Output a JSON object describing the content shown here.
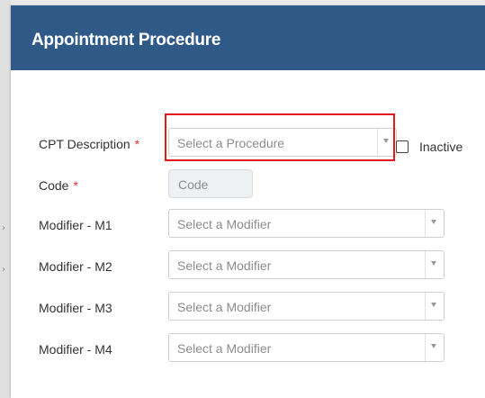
{
  "dialog": {
    "title": "Appointment Procedure"
  },
  "form": {
    "cpt": {
      "label": "CPT Description",
      "required_mark": "*",
      "placeholder": "Select a Procedure",
      "inactive_label": "Inactive",
      "inactive_checked": false
    },
    "code": {
      "label": "Code",
      "required_mark": "*",
      "placeholder": "Code"
    },
    "modifiers": [
      {
        "label": "Modifier - M1",
        "placeholder": "Select a Modifier"
      },
      {
        "label": "Modifier - M2",
        "placeholder": "Select a Modifier"
      },
      {
        "label": "Modifier - M3",
        "placeholder": "Select a Modifier"
      },
      {
        "label": "Modifier - M4",
        "placeholder": "Select a Modifier"
      }
    ]
  },
  "colors": {
    "header": "#2f5a87",
    "highlight": "#e3191b",
    "required": "#e53935"
  }
}
